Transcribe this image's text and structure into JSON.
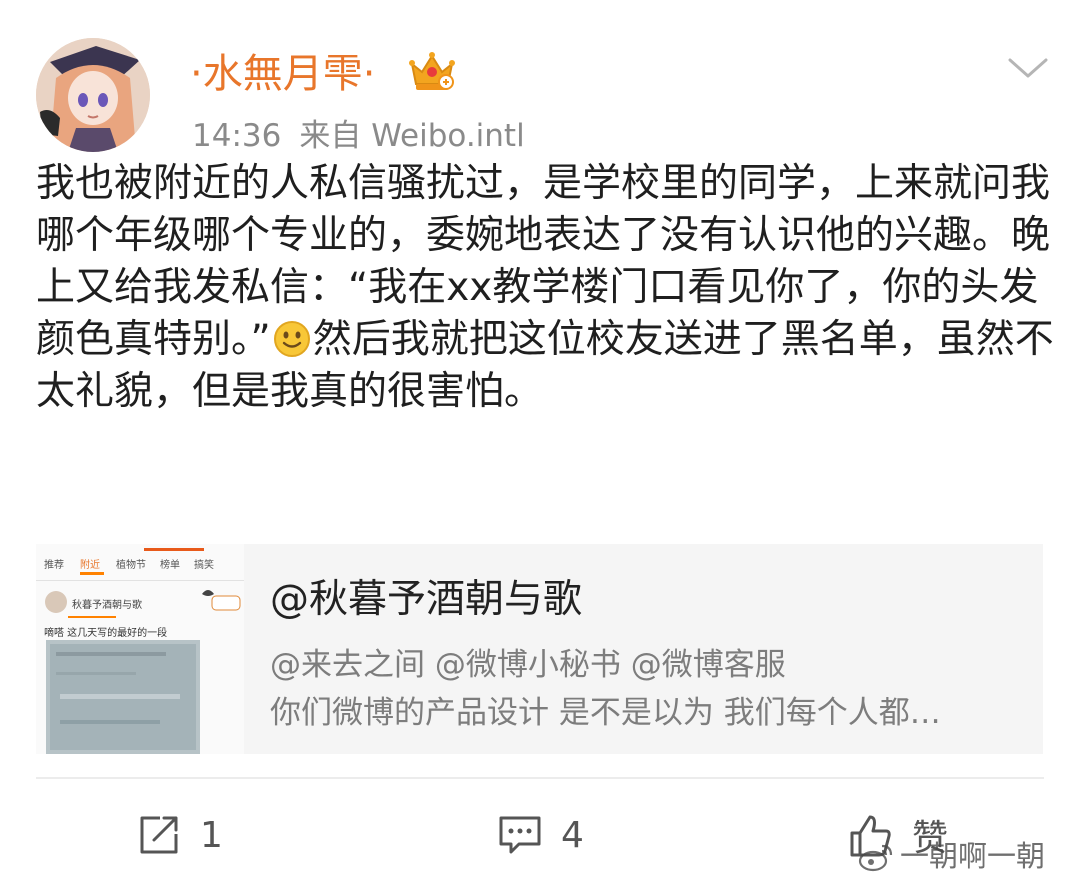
{
  "user": {
    "name": "·水無月雫·",
    "time": "14:36",
    "source": "来自 Weibo.intl"
  },
  "post": {
    "text_before_emoji": "我也被附近的人私信骚扰过，是学校里的同学，上来就问我哪个年级哪个专业的，委婉地表达了没有认识他的兴趣。晚上又给我发私信：“我在xx教学楼门口看见你了，你的头发颜色真特别。”",
    "text_after_emoji": "然后我就把这位校友送进了黑名单，虽然不太礼貌，但是我真的很害怕。"
  },
  "card": {
    "title": "@秋暮予酒朝与歌",
    "line1": "@来去之间 @微博小秘书 @微博客服",
    "line2": "你们微博的产品设计 是不是以为 我们每个人都…",
    "thumb_tabs": [
      "推荐",
      "附近",
      "植物节",
      "榜单",
      "搞笑"
    ],
    "thumb_user": "秋暮予酒朝与歌",
    "thumb_text": "嘀嗒 这几天写的最好的一段"
  },
  "actions": {
    "repost_count": "1",
    "comment_count": "4",
    "like_label": "赞"
  },
  "watermark": "一朝啊一朝",
  "colors": {
    "username": "#e8762b",
    "meta": "#8a8a8a",
    "card_bg": "#f5f5f5"
  }
}
